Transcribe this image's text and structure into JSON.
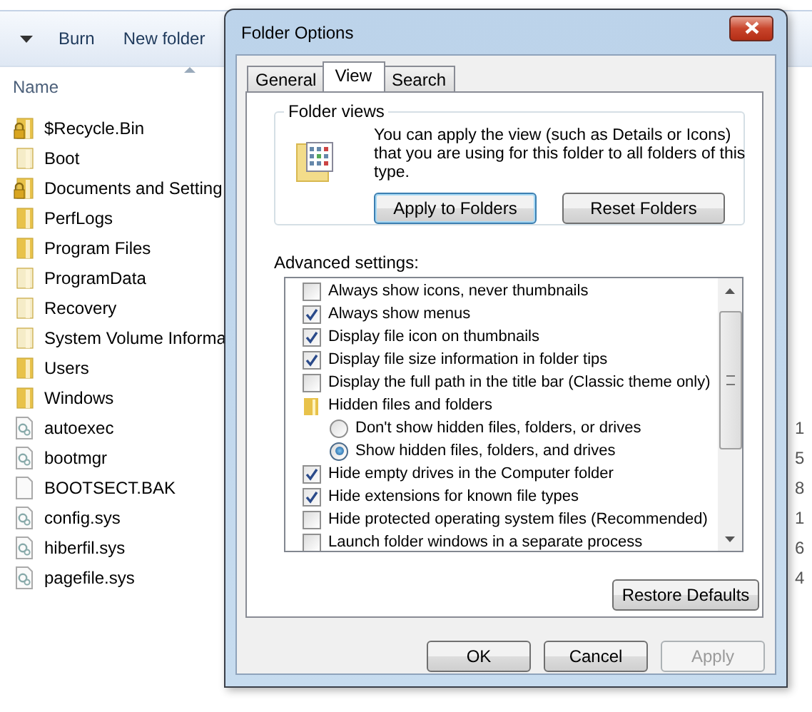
{
  "explorer": {
    "toolbar": [
      "Burn",
      "New folder"
    ],
    "column": "Name",
    "files": [
      {
        "name": "$Recycle.Bin",
        "kind": "locked-folder"
      },
      {
        "name": "Boot",
        "kind": "hidden-folder"
      },
      {
        "name": "Documents and Setting",
        "kind": "locked-folder"
      },
      {
        "name": "PerfLogs",
        "kind": "folder"
      },
      {
        "name": "Program Files",
        "kind": "folder"
      },
      {
        "name": "ProgramData",
        "kind": "hidden-folder"
      },
      {
        "name": "Recovery",
        "kind": "hidden-folder"
      },
      {
        "name": "System Volume Informa",
        "kind": "hidden-folder"
      },
      {
        "name": "Users",
        "kind": "folder"
      },
      {
        "name": "Windows",
        "kind": "folder"
      },
      {
        "name": "autoexec",
        "kind": "system-file",
        "size": "1"
      },
      {
        "name": "bootmgr",
        "kind": "system-file",
        "size": "5"
      },
      {
        "name": "BOOTSECT.BAK",
        "kind": "file",
        "size": "8"
      },
      {
        "name": "config.sys",
        "kind": "system-file",
        "size": "1"
      },
      {
        "name": "hiberfil.sys",
        "kind": "system-file",
        "size": "6"
      },
      {
        "name": "pagefile.sys",
        "kind": "system-file",
        "size": "4"
      }
    ]
  },
  "dialog": {
    "title": "Folder Options",
    "tabs": [
      {
        "label": "General",
        "selected": false
      },
      {
        "label": "View",
        "selected": true
      },
      {
        "label": "Search",
        "selected": false
      }
    ],
    "folder_views": {
      "legend": "Folder views",
      "text": "You can apply the view (such as Details or Icons) that you are using for this folder to all folders of this type.",
      "buttons": [
        {
          "label": "Apply to Folders",
          "focused": true
        },
        {
          "label": "Reset Folders",
          "focused": false
        }
      ]
    },
    "advanced_label": "Advanced settings:",
    "settings": [
      {
        "kind": "checkbox",
        "label": "Always show icons, never thumbnails",
        "checked": false
      },
      {
        "kind": "checkbox",
        "label": "Always show menus",
        "checked": true
      },
      {
        "kind": "checkbox",
        "label": "Display file icon on thumbnails",
        "checked": true
      },
      {
        "kind": "checkbox",
        "label": "Display file size information in folder tips",
        "checked": true
      },
      {
        "kind": "checkbox",
        "label": "Display the full path in the title bar (Classic theme only)",
        "checked": false
      },
      {
        "kind": "group",
        "label": "Hidden files and folders",
        "children": [
          {
            "kind": "radio",
            "label": "Don't show hidden files, folders, or drives",
            "selected": false
          },
          {
            "kind": "radio",
            "label": "Show hidden files, folders, and drives",
            "selected": true
          }
        ]
      },
      {
        "kind": "checkbox",
        "label": "Hide empty drives in the Computer folder",
        "checked": true
      },
      {
        "kind": "checkbox",
        "label": "Hide extensions for known file types",
        "checked": true
      },
      {
        "kind": "checkbox",
        "label": "Hide protected operating system files (Recommended)",
        "checked": false
      },
      {
        "kind": "checkbox",
        "label": "Launch folder windows in a separate process",
        "checked": false
      }
    ],
    "restore": "Restore Defaults",
    "buttons": [
      {
        "label": "OK",
        "disabled": false
      },
      {
        "label": "Cancel",
        "disabled": false
      },
      {
        "label": "Apply",
        "disabled": true
      }
    ]
  }
}
